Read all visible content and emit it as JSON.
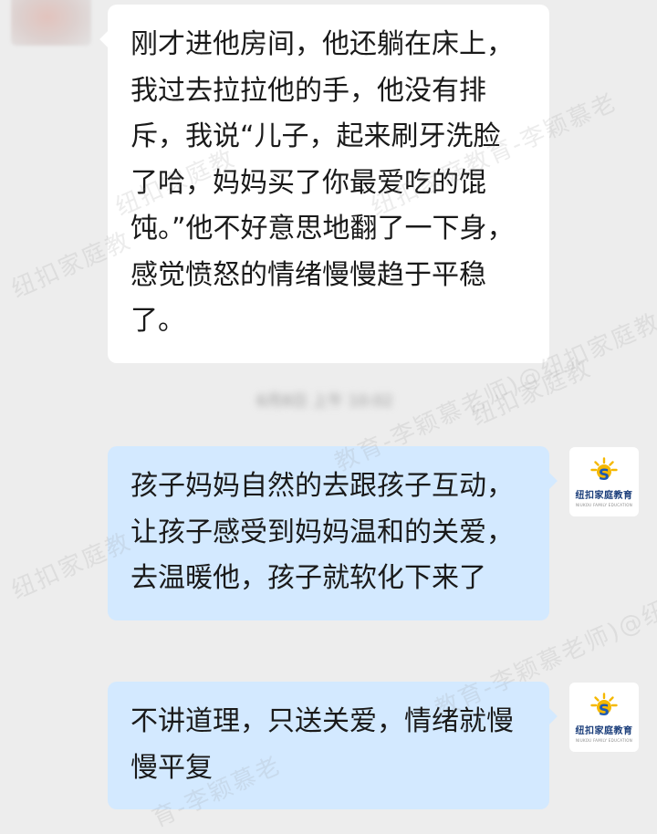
{
  "messages": [
    {
      "id": "msg-1",
      "side": "left",
      "text": "刚才进他房间，他还躺在床上，我过去拉拉他的手，他没有排斥，我说“儿子，起来刷牙洗脸了哈，妈妈买了你最爱吃的馄饨。”他不好意思地翻了一下身，感觉愤怒的情绪慢慢趋于平稳了。"
    },
    {
      "id": "msg-2",
      "side": "right",
      "text": "孩子妈妈自然的去跟孩子互动，让孩子感受到妈妈温和的关爱，去温暖他，孩子就软化下来了"
    },
    {
      "id": "msg-3",
      "side": "right",
      "text": "不讲道理，只送关爱，情绪就慢慢平复"
    }
  ],
  "timestamp": "6月8日 上午 10:02",
  "sender_avatar": {
    "icon": "blurred-avatar"
  },
  "coach_avatar": {
    "name": "纽扣家庭教育",
    "subtitle": "NIUKOU FAMILY EDUCATION",
    "icon": "sun-s-logo-icon"
  },
  "watermarks": [
    "纽扣家庭教",
    "纽扣家庭教",
    "纽扣家庭教育-李颖慕老",
    "教育-李颖慕老师)@纽扣家庭教",
    "纽扣家庭教",
    "教育-李颖慕老师)@纽扣家庭教",
    "纽扣家庭教",
    "育-李颖慕老"
  ],
  "colors": {
    "background": "#ededed",
    "incoming_bubble": "#ffffff",
    "outgoing_bubble": "#d3e9ff",
    "logo_sun": "#f5b800",
    "logo_s": "#1e5ab4"
  }
}
